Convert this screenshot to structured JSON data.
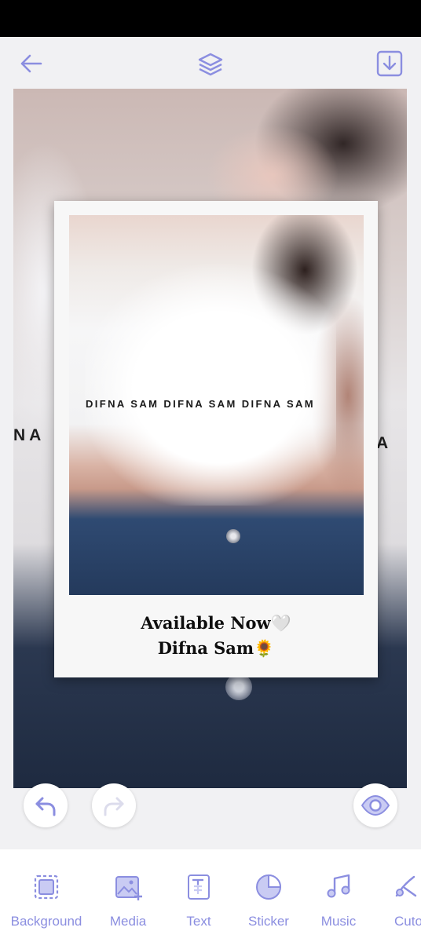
{
  "top_bar": {
    "back_icon": "arrow-left-icon",
    "layers_icon": "layers-icon",
    "save_icon": "download-icon"
  },
  "canvas": {
    "background_text_left": "NA",
    "background_text_right": "A",
    "shirt_text": "DIFNA SAM DIFNA SAM DIFNA SAM",
    "caption_line1": "Available Now🤍",
    "caption_line2": "Difna Sam🌻"
  },
  "actions": {
    "undo_icon": "undo-icon",
    "redo_icon": "redo-icon",
    "preview_icon": "eye-icon"
  },
  "toolbar": {
    "items": [
      {
        "label": "Background",
        "icon": "background-icon"
      },
      {
        "label": "Media",
        "icon": "media-icon"
      },
      {
        "label": "Text",
        "icon": "text-icon"
      },
      {
        "label": "Sticker",
        "icon": "sticker-icon"
      },
      {
        "label": "Music",
        "icon": "music-icon"
      },
      {
        "label": "Cuto",
        "icon": "cutout-icon"
      }
    ]
  },
  "colors": {
    "accent": "#8b8ee0",
    "accent_light": "#c9cbf3",
    "background": "#f1f1f3"
  }
}
